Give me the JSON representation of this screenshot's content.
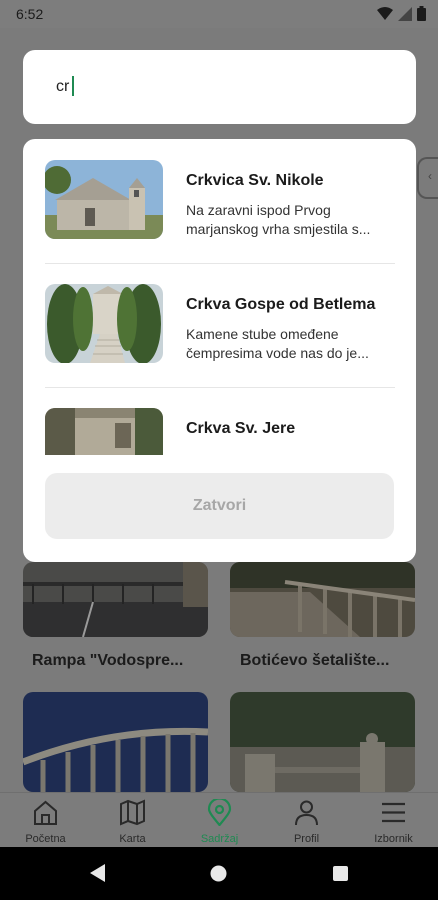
{
  "status": {
    "time": "6:52"
  },
  "search": {
    "value": "cr"
  },
  "results": [
    {
      "title": "Crkvica Sv. Nikole",
      "desc_line1": "Na zaravni ispod Prvog",
      "desc_line2": "marjanskog vrha smjestila s..."
    },
    {
      "title": "Crkva Gospe od Betlema",
      "desc_line1": "Kamene stube omeđene",
      "desc_line2": "čempresima vode nas do je..."
    },
    {
      "title": "Crkva Sv. Jere",
      "desc_line1": "",
      "desc_line2": ""
    }
  ],
  "close_label": "Zatvori",
  "tiles": [
    {
      "label": "Rampa \"Vodospre..."
    },
    {
      "label": "Botićevo šetalište..."
    }
  ],
  "nav": [
    {
      "label": "Početna",
      "icon": "home-icon"
    },
    {
      "label": "Karta",
      "icon": "map-icon"
    },
    {
      "label": "Sadržaj",
      "icon": "location-pin-icon",
      "active": true
    },
    {
      "label": "Profil",
      "icon": "profile-icon"
    },
    {
      "label": "Izbornik",
      "icon": "menu-icon"
    }
  ],
  "colors": {
    "accent": "#1f8a52",
    "overlay": "#7b7b7b"
  }
}
